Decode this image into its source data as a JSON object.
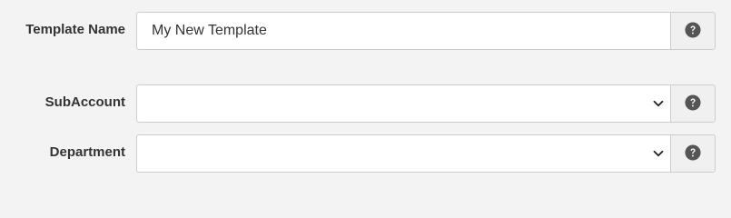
{
  "form": {
    "template_name": {
      "label": "Template Name",
      "value": "My New Template",
      "help_icon": "question-circle-icon"
    },
    "subaccount": {
      "label": "SubAccount",
      "selected": "",
      "help_icon": "question-circle-icon"
    },
    "department": {
      "label": "Department",
      "selected": "",
      "help_icon": "question-circle-icon"
    }
  },
  "colors": {
    "background": "#f3f3f3",
    "input_border": "#cccccc",
    "addon_background": "#f0f0f0",
    "icon": "#555555",
    "label_text": "#333333"
  }
}
